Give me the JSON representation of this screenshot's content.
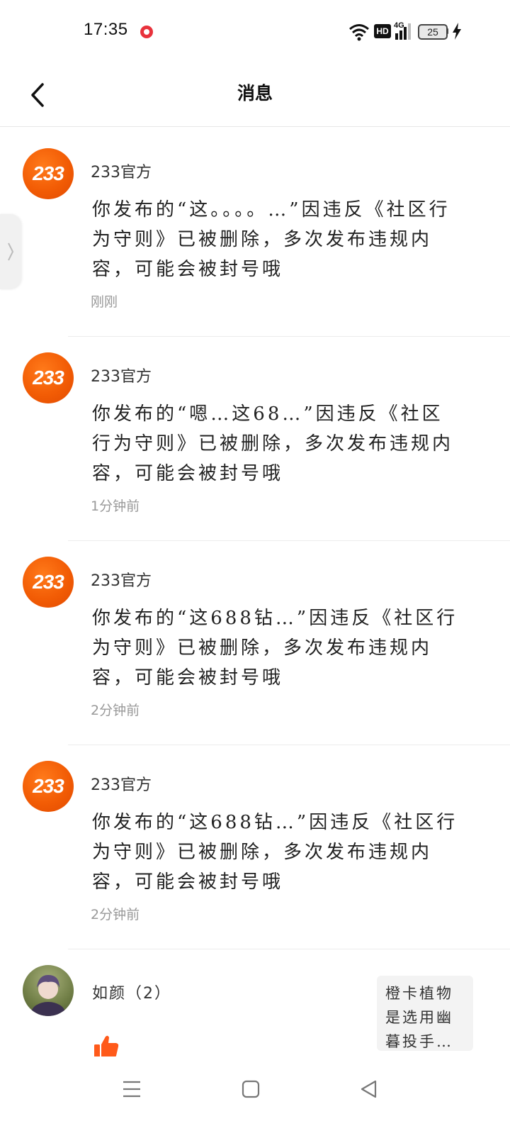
{
  "status_bar": {
    "time": "17:35",
    "network_hd": "HD",
    "network_gen": "4G",
    "battery_level": "25"
  },
  "header": {
    "title": "消息"
  },
  "messages": [
    {
      "avatar_text": "233",
      "sender": "233官方",
      "body": "你发布的“这。。。。…”因违反《社区行为守则》已被删除，多次发布违规内容，可能会被封号哦",
      "time": "刚刚"
    },
    {
      "avatar_text": "233",
      "sender": "233官方",
      "body": "你发布的“嗯…这68…”因违反《社区行为守则》已被删除，多次发布违规内容，可能会被封号哦",
      "time": "1分钟前"
    },
    {
      "avatar_text": "233",
      "sender": "233官方",
      "body": "你发布的“这688钻…”因违反《社区行为守则》已被删除，多次发布违规内容，可能会被封号哦",
      "time": "2分钟前"
    },
    {
      "avatar_text": "233",
      "sender": "233官方",
      "body": "你发布的“这688钻…”因违反《社区行为守则》已被删除，多次发布违规内容，可能会被封号哦",
      "time": "2分钟前"
    }
  ],
  "user_message": {
    "sender": "如颜（2）",
    "preview": "橙卡植物是选用幽暮投手…"
  },
  "colors": {
    "brand_orange": "#f25c05",
    "like_orange": "#ff5a1a"
  },
  "icons": {
    "back": "chevron-left-icon",
    "like": "thumbs-up-icon",
    "menu": "menu-icon",
    "home": "square-home-icon",
    "back_nav": "triangle-back-icon"
  }
}
